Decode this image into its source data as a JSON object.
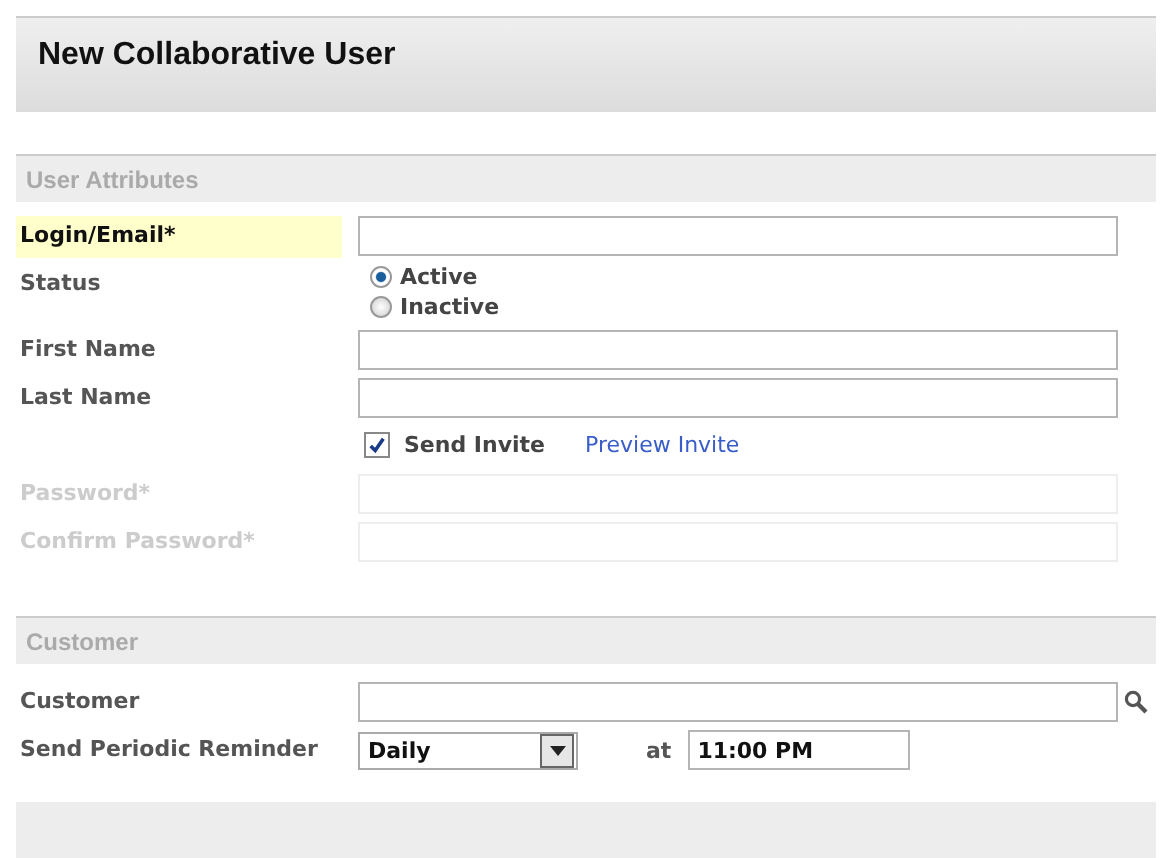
{
  "header": {
    "title": "New Collaborative User"
  },
  "sections": [
    {
      "title": "User Attributes",
      "rows": [
        {
          "kind": "text",
          "label": "Login/Email*",
          "highlighted": true,
          "disabled": false,
          "value": ""
        },
        {
          "kind": "radio",
          "label": "Status",
          "options": [
            {
              "label": "Active",
              "selected": true
            },
            {
              "label": "Inactive",
              "selected": false
            }
          ]
        },
        {
          "kind": "text",
          "label": "First Name",
          "highlighted": false,
          "disabled": false,
          "value": ""
        },
        {
          "kind": "text",
          "label": "Last Name",
          "highlighted": false,
          "disabled": false,
          "value": ""
        },
        {
          "kind": "checkbox",
          "label": "Send Invite",
          "checked": true,
          "link": "Preview Invite"
        },
        {
          "kind": "text",
          "label": "Password*",
          "highlighted": false,
          "disabled": true,
          "value": ""
        },
        {
          "kind": "text",
          "label": "Confirm Password*",
          "highlighted": false,
          "disabled": true,
          "value": ""
        }
      ]
    },
    {
      "title": "Customer",
      "rows": [
        {
          "kind": "lookup",
          "label": "Customer",
          "value": ""
        },
        {
          "kind": "schedule",
          "label": "Send Periodic Reminder",
          "value": "Daily",
          "at_label": "at",
          "time": "11:00 PM"
        }
      ]
    }
  ]
}
